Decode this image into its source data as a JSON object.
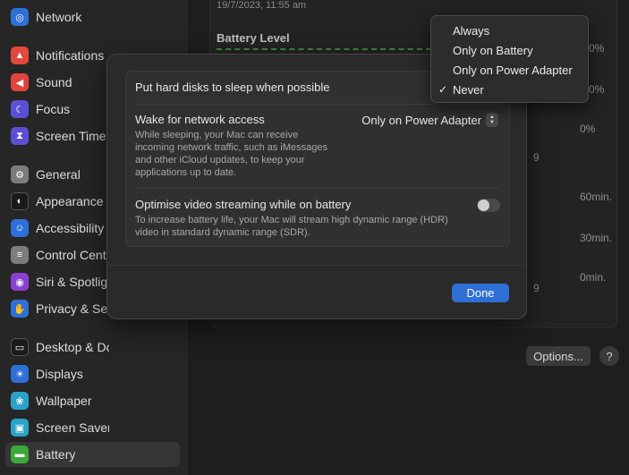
{
  "sidebar": {
    "items": [
      {
        "label": "Network",
        "icon": "globe-icon",
        "color": "#2e6fd8",
        "glyph": "◎"
      },
      {
        "label": "Notifications",
        "icon": "bell-icon",
        "color": "#e2483d",
        "glyph": "▲"
      },
      {
        "label": "Sound",
        "icon": "speaker-icon",
        "color": "#e0443c",
        "glyph": "◀"
      },
      {
        "label": "Focus",
        "icon": "moon-icon",
        "color": "#5b4fd6",
        "glyph": "☾"
      },
      {
        "label": "Screen Time",
        "icon": "hourglass-icon",
        "color": "#5b4fd6",
        "glyph": "⧗"
      },
      {
        "label": "General",
        "icon": "gear-icon",
        "color": "#7c7c7c",
        "glyph": "⚙"
      },
      {
        "label": "Appearance",
        "icon": "appearance-icon",
        "color": "#1a1a1a",
        "glyph": "◐"
      },
      {
        "label": "Accessibility",
        "icon": "accessibility-icon",
        "color": "#2e6fd8",
        "glyph": "☺"
      },
      {
        "label": "Control Centre",
        "icon": "switches-icon",
        "color": "#7c7c7c",
        "glyph": "≡"
      },
      {
        "label": "Siri & Spotlight",
        "icon": "siri-icon",
        "color": "#8a3fd1",
        "glyph": "◉"
      },
      {
        "label": "Privacy & Security",
        "icon": "hand-icon",
        "color": "#2e6fd8",
        "glyph": "✋"
      },
      {
        "label": "Desktop & Dock",
        "icon": "dock-icon",
        "color": "#1a1a1a",
        "glyph": "▭"
      },
      {
        "label": "Displays",
        "icon": "sun-icon",
        "color": "#2e6fd8",
        "glyph": "☀"
      },
      {
        "label": "Wallpaper",
        "icon": "flower-icon",
        "color": "#2aa3c9",
        "glyph": "❀"
      },
      {
        "label": "Screen Saver",
        "icon": "screensaver-icon",
        "color": "#2aa3c9",
        "glyph": "▣"
      },
      {
        "label": "Battery",
        "icon": "battery-icon",
        "color": "#3aa83a",
        "glyph": "▬"
      }
    ]
  },
  "main": {
    "date": "19/7/2023, 11:55 am",
    "battery_level_title": "Battery Level",
    "axis_top": [
      "0%",
      "0%",
      "0%"
    ],
    "axis_mid": [
      "9"
    ],
    "axis_bottom": [
      "60min.",
      "30min.",
      "0min."
    ],
    "axis_bottom_x": [
      "9"
    ],
    "options_label": "Options...",
    "help_label": "?"
  },
  "sheet": {
    "row1_title": "Put hard disks to sleep when possible",
    "row2_title": "Wake for network access",
    "row2_desc": "While sleeping, your Mac can receive incoming network traffic, such as iMessages and other iCloud updates, to keep your applications up to date.",
    "row2_value": "Only on Power Adapter",
    "row3_title": "Optimise video streaming while on battery",
    "row3_desc": "To increase battery life, your Mac will stream high dynamic range (HDR) video in standard dynamic range (SDR).",
    "row3_toggle_on": false,
    "done_label": "Done"
  },
  "menu": {
    "options": [
      "Always",
      "Only on Battery",
      "Only on Power Adapter",
      "Never"
    ],
    "selected": "Never",
    "check_glyph": "✓"
  }
}
